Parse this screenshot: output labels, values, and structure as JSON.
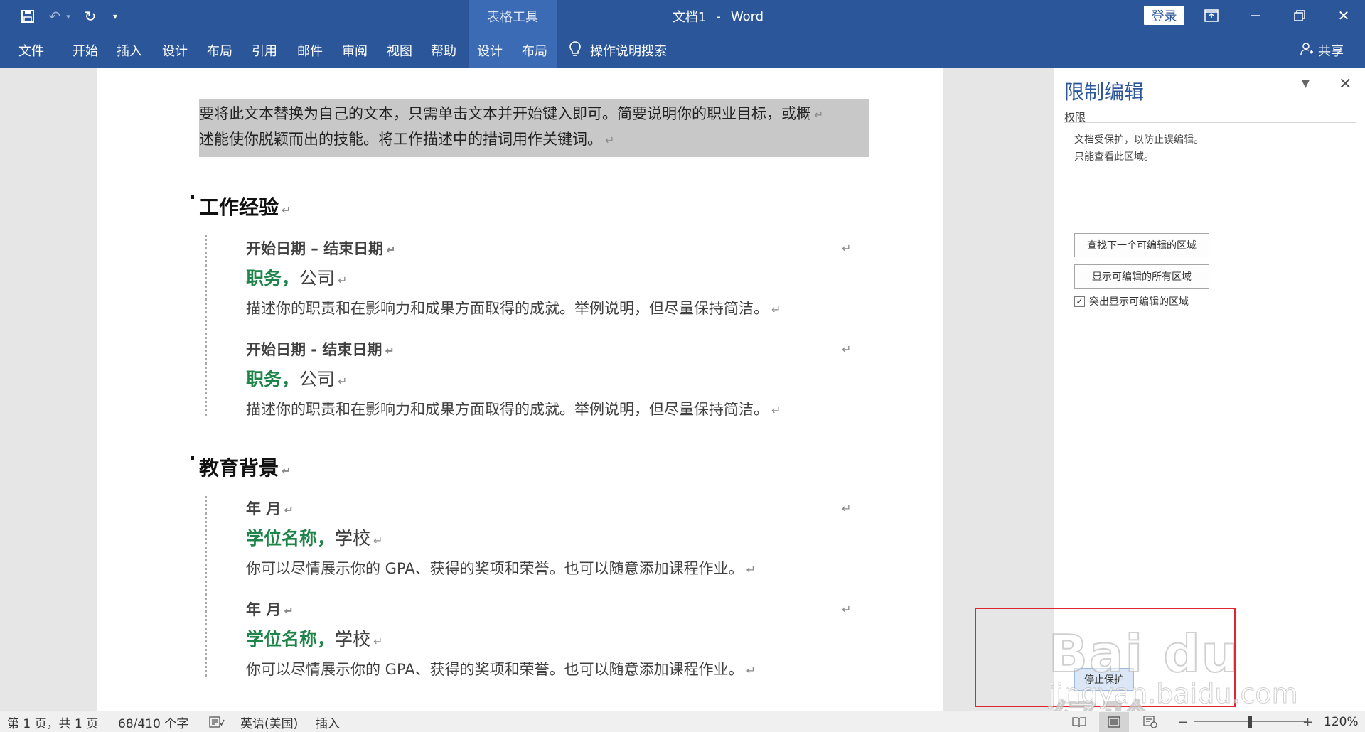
{
  "titlebar": {
    "context_tab_group": "表格工具",
    "document_name": "文档1",
    "separator": "-",
    "app_name": "Word",
    "signin_label": "登录"
  },
  "ribbon": {
    "tabs": [
      "文件",
      "开始",
      "插入",
      "设计",
      "布局",
      "引用",
      "邮件",
      "审阅",
      "视图",
      "帮助"
    ],
    "context_tabs": [
      "设计",
      "布局"
    ],
    "tell_me": "操作说明搜索",
    "share": "共享"
  },
  "document": {
    "intro_lines": [
      "要将此文本替换为自己的文本，只需单击文本并开始键入即可。简要说明你的职业目标，或概",
      "述能使你脱颖而出的技能。将工作描述中的措词用作关键词。"
    ],
    "paragraph_mark": "↵",
    "sections": [
      {
        "heading": "工作经验",
        "entries": [
          {
            "date": "开始日期 – 结束日期",
            "title": "职务，",
            "org": "公司",
            "desc": "描述你的职责和在影响力和成果方面取得的成就。举例说明，但尽量保持简洁。"
          },
          {
            "date": "开始日期 - 结束日期",
            "title": "职务，",
            "org": "公司",
            "desc": "描述你的职责和在影响力和成果方面取得的成就。举例说明，但尽量保持简洁。"
          }
        ]
      },
      {
        "heading": "教育背景",
        "entries": [
          {
            "date": "年 月",
            "title": "学位名称，",
            "org": "学校",
            "desc": "你可以尽情展示你的 GPA、获得的奖项和荣誉。也可以随意添加课程作业。"
          },
          {
            "date": "年 月",
            "title": "学位名称，",
            "org": "学校",
            "desc": "你可以尽情展示你的 GPA、获得的奖项和荣誉。也可以随意添加课程作业。"
          }
        ]
      }
    ]
  },
  "restrict_pane": {
    "title": "限制编辑",
    "permissions_label": "权限",
    "info_line1": "文档受保护，以防止误编辑。",
    "info_line2": "只能查看此区域。",
    "find_next_button": "查找下一个可编辑的区域",
    "show_all_button": "显示可编辑的所有区域",
    "highlight_checkbox_label": "突出显示可编辑的区域",
    "highlight_checked": true,
    "stop_protection_button": "停止保护"
  },
  "watermark": {
    "brand": "Bai du 经验",
    "site": "jingyan.baidu.com"
  },
  "statusbar": {
    "page_info": "第 1 页，共 1 页",
    "word_count": "68/410 个字",
    "language": "英语(美国)",
    "mode": "插入",
    "zoom": "120%"
  }
}
